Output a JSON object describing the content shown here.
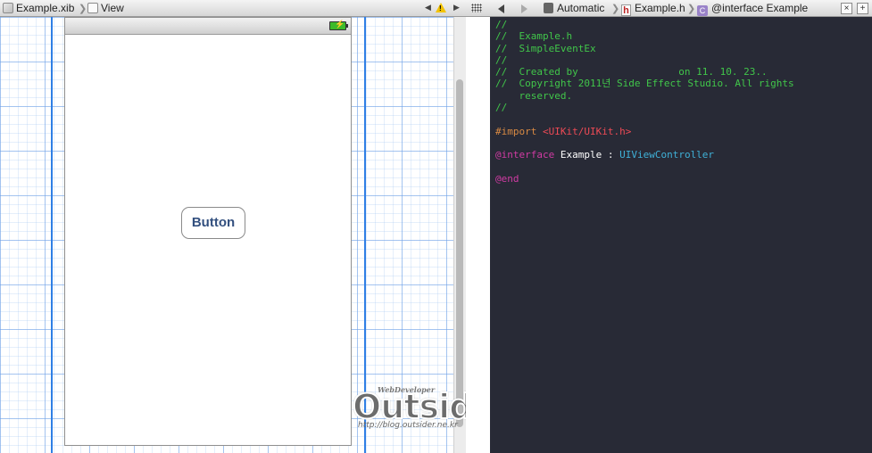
{
  "ib": {
    "jump_bar": {
      "file": "Example.xib",
      "view": "View"
    },
    "button_label": "Button"
  },
  "editor": {
    "jump_bar": {
      "automatic": "Automatic",
      "file": "Example.h",
      "symbol": "@interface Example"
    },
    "code": {
      "comments": [
        "//",
        "//  Example.h",
        "//  SimpleEventEx",
        "//",
        "//  Created by                 on 11. 10. 23..",
        "//  Copyright 2011년 Side Effect Studio. All rights",
        "    reserved.",
        "//"
      ],
      "import_directive": "#import",
      "import_path": "<UIKit/UIKit.h>",
      "interface_keyword": "@interface",
      "class_name": "Example :",
      "superclass": "UIViewController",
      "end_keyword": "@end"
    }
  },
  "watermark": {
    "top": "WebDeveloper",
    "logo": "Outsider",
    "url": "http://blog.outsider.ne.kr"
  }
}
